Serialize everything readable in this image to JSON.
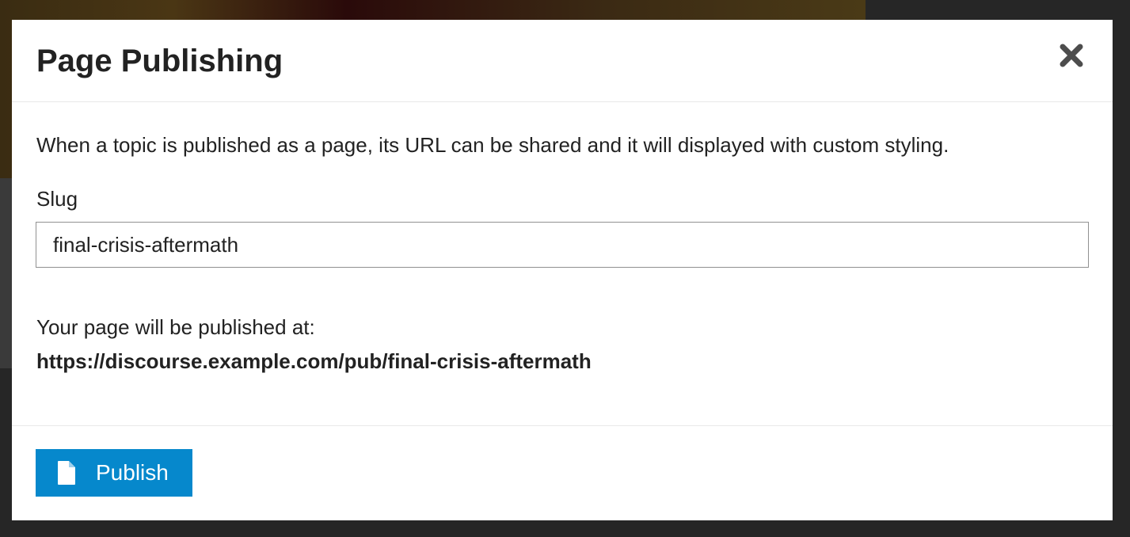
{
  "modal": {
    "title": "Page Publishing",
    "description": "When a topic is published as a page, its URL can be shared and it will displayed with custom styling.",
    "slug_label": "Slug",
    "slug_value": "final-crisis-aftermath",
    "publish_info_label": "Your page will be published at:",
    "publish_url": "https://discourse.example.com/pub/final-crisis-aftermath",
    "publish_button_label": "Publish",
    "close_icon": "close-icon",
    "publish_icon": "file-icon"
  },
  "colors": {
    "primary": "#0688cc",
    "text": "#222222",
    "backdrop": "#202020"
  }
}
